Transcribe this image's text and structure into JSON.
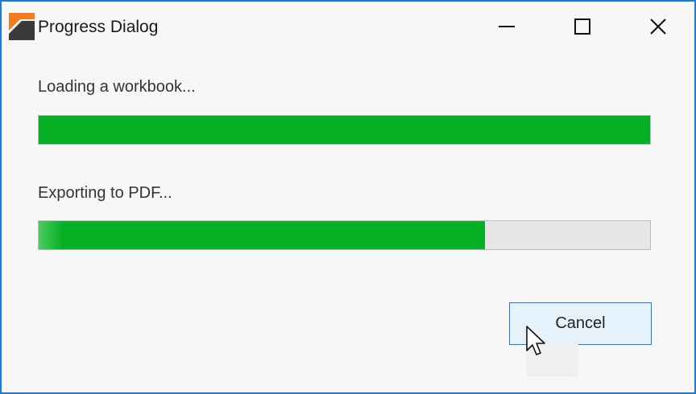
{
  "window": {
    "title": "Progress Dialog",
    "accent_color": "#1f7ad6"
  },
  "titlebar": {
    "app_icon": "app-logo-icon",
    "controls": {
      "minimize": "minimize-icon",
      "maximize": "maximize-icon",
      "close": "close-icon"
    }
  },
  "tasks": [
    {
      "label": "Loading a workbook...",
      "progress": 1.0,
      "color": "#06b025"
    },
    {
      "label": "Exporting to PDF...",
      "progress": 0.73,
      "color": "#06b025"
    }
  ],
  "actions": {
    "cancel_label": "Cancel"
  }
}
